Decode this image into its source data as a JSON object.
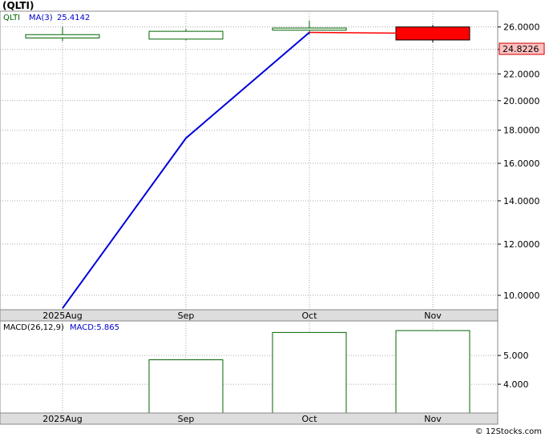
{
  "header": {
    "title": "(QLTI)",
    "legend_symbol": "QLTI",
    "legend_ma_label": "MA(3)",
    "legend_ma_value": "25.4142"
  },
  "macd_legend": {
    "label": "MACD(26,12,9)",
    "value_label": "MACD:5.865"
  },
  "last_price_label": "24.8226",
  "footer": "© 12Stocks.com",
  "colors": {
    "background": "#ffffff",
    "grid": "#aaaaaa",
    "candle_up": "#006400",
    "candle_down": "#ff0000",
    "ma_line": "#0000dd",
    "ma_line_last": "#ff0000",
    "axis_band": "#dddddd",
    "legend_symbol": "#006400",
    "legend_ma": "#0000cc",
    "price_label_bg": "#ffc0c0"
  },
  "chart_data": [
    {
      "type": "candlestick",
      "title": "(QLTI)",
      "x_categories": [
        "2025Aug",
        "Sep",
        "Oct",
        "Nov"
      ],
      "x_tick_labels": [
        "2025Aug",
        "Sep",
        "Oct",
        "Nov"
      ],
      "y_scale": "log",
      "y_ticks": [
        "10.0000",
        "12.0000",
        "14.0000",
        "16.0000",
        "18.0000",
        "20.0000",
        "22.0000",
        "24.0000",
        "26.0000"
      ],
      "y_tick_values": [
        10,
        12,
        14,
        16,
        18,
        20,
        22,
        24,
        26
      ],
      "ylim": [
        9.5,
        27.5
      ],
      "grid": true,
      "candles": [
        {
          "period": "Aug",
          "open": 25.0,
          "high": 26.0,
          "low": 24.7,
          "close": 25.3,
          "direction": "up"
        },
        {
          "period": "Sep",
          "open": 24.9,
          "high": 25.8,
          "low": 24.8,
          "close": 25.6,
          "direction": "up"
        },
        {
          "period": "Oct",
          "open": 25.7,
          "high": 26.6,
          "low": 25.3,
          "close": 25.9,
          "direction": "up"
        },
        {
          "period": "Nov",
          "open": 26.0,
          "high": 26.2,
          "low": 24.6,
          "close": 24.8226,
          "direction": "down"
        }
      ],
      "series": [
        {
          "name": "MA(3)",
          "values": [
            9.55,
            17.5,
            25.5,
            25.4142
          ]
        }
      ]
    },
    {
      "type": "bar",
      "title": "MACD(26,12,9)",
      "categories": [
        "2025Aug",
        "Sep",
        "Oct",
        "Nov"
      ],
      "x_tick_labels": [
        "2025Aug",
        "Sep",
        "Oct",
        "Nov"
      ],
      "values": [
        null,
        4.85,
        5.8,
        5.865
      ],
      "y_ticks": [
        "4.000",
        "5.000"
      ],
      "y_tick_values": [
        4,
        5
      ],
      "ylim": [
        3.0,
        6.2
      ],
      "grid": true
    }
  ]
}
